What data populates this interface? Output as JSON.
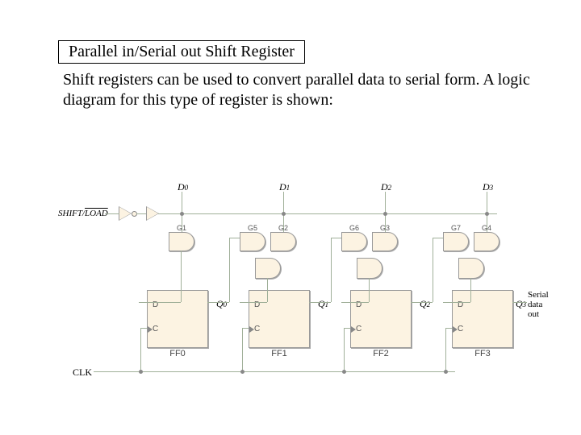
{
  "title": "Parallel in/Serial out Shift Register",
  "description": "Shift registers can be used to convert parallel data to serial form. A logic diagram for this type of register is shown:",
  "control_signal": {
    "shift": "SHIFT",
    "load": "LOAD",
    "sep": "/"
  },
  "clock": "CLK",
  "serial_out_line1": "Serial",
  "serial_out_line2": "data out",
  "inputs": [
    "D",
    "D",
    "D",
    "D"
  ],
  "input_subs": [
    "0",
    "1",
    "2",
    "3"
  ],
  "outputs": [
    "Q",
    "Q",
    "Q",
    "Q"
  ],
  "output_subs": [
    "0",
    "1",
    "2",
    "3"
  ],
  "flipflops": [
    "FF0",
    "FF1",
    "FF2",
    "FF3"
  ],
  "gates": [
    "G1",
    "G5",
    "G2",
    "G6",
    "G3",
    "G7",
    "G4"
  ],
  "pin_d": "D",
  "pin_c": "C"
}
